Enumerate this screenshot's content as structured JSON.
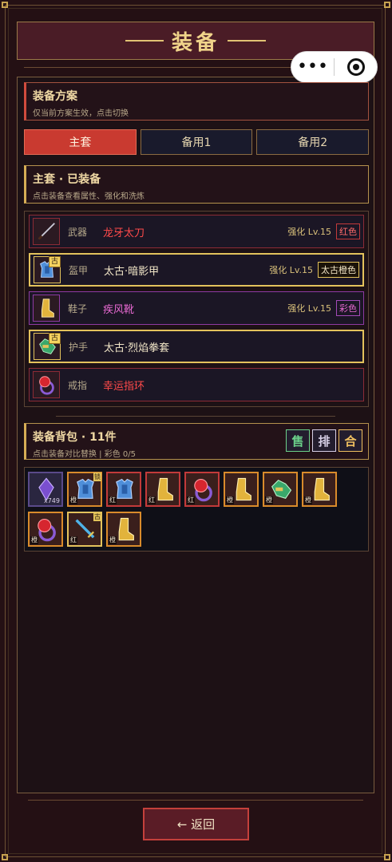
{
  "header": {
    "title": "装备"
  },
  "mini_capsule": {
    "more_icon": "ellipsis-icon",
    "close_icon": "target-circle-icon"
  },
  "scheme": {
    "title": "装备方案",
    "subtitle": "仅当前方案生效，点击切换"
  },
  "tabs": [
    {
      "label": "主套",
      "active": true
    },
    {
      "label": "备用1",
      "active": false
    },
    {
      "label": "备用2",
      "active": false
    }
  ],
  "equipped": {
    "title": "主套 · 已装备",
    "subtitle": "点击装备查看属性、强化和洗炼"
  },
  "equip_rows": [
    {
      "slot": "武器",
      "name": "龙牙太刀",
      "level": "强化 Lv.15",
      "tag": "红色",
      "color": "#ff4a4a",
      "border": "#8b2b36",
      "icon": "sword-icon",
      "badge": ""
    },
    {
      "slot": "盔甲",
      "name": "太古·暗影甲",
      "level": "强化 Lv.15",
      "tag": "太古橙色",
      "color": "#f2e6c8",
      "border": "#e3c25c",
      "icon": "armor-icon",
      "badge": "古"
    },
    {
      "slot": "鞋子",
      "name": "疾风靴",
      "level": "强化 Lv.15",
      "tag": "彩色",
      "color": "#e86ad2",
      "border": "#8e3aa3",
      "icon": "boots-icon",
      "badge": ""
    },
    {
      "slot": "护手",
      "name": "太古·烈焰拳套",
      "level": "",
      "tag": "",
      "color": "#f2e6c8",
      "border": "#e3c25c",
      "icon": "gauntlet-icon",
      "badge": "古"
    },
    {
      "slot": "戒指",
      "name": "幸运指环",
      "level": "",
      "tag": "",
      "color": "#ff4a4a",
      "border": "#8b2b36",
      "icon": "ring-icon",
      "badge": ""
    }
  ],
  "bag": {
    "title": "装备背包 · 11件",
    "subtitle": "点击装备对比替换 | 彩色 0/5",
    "buttons": [
      {
        "label": "售",
        "color": "#6bd18a"
      },
      {
        "label": "排",
        "color": "#d6cfe6"
      },
      {
        "label": "合",
        "color": "#f0c060"
      }
    ],
    "items": [
      {
        "icon": "crystal-icon",
        "quality": "",
        "count": "x749",
        "badge": "",
        "border": "#5a4a8a"
      },
      {
        "icon": "armor-icon",
        "quality": "橙",
        "count": "",
        "badge": "锁",
        "border": "#d98b2b"
      },
      {
        "icon": "armor-icon",
        "quality": "红",
        "count": "",
        "badge": "",
        "border": "#c23a3a"
      },
      {
        "icon": "boots-icon",
        "quality": "红",
        "count": "",
        "badge": "",
        "border": "#c23a3a"
      },
      {
        "icon": "ring-icon",
        "quality": "红",
        "count": "",
        "badge": "",
        "border": "#c23a3a"
      },
      {
        "icon": "boots-icon",
        "quality": "橙",
        "count": "",
        "badge": "",
        "border": "#d98b2b"
      },
      {
        "icon": "gauntlet-icon",
        "quality": "橙",
        "count": "",
        "badge": "",
        "border": "#d98b2b"
      },
      {
        "icon": "boots-icon",
        "quality": "橙",
        "count": "",
        "badge": "",
        "border": "#d98b2b"
      },
      {
        "icon": "ring-icon",
        "quality": "橙",
        "count": "",
        "badge": "",
        "border": "#d98b2b"
      },
      {
        "icon": "dagger-icon",
        "quality": "红",
        "count": "",
        "badge": "古",
        "border": "#e3c25c"
      },
      {
        "icon": "boots-icon",
        "quality": "橙",
        "count": "",
        "badge": "",
        "border": "#d98b2b"
      }
    ]
  },
  "footer": {
    "back_label": "← 返回"
  }
}
